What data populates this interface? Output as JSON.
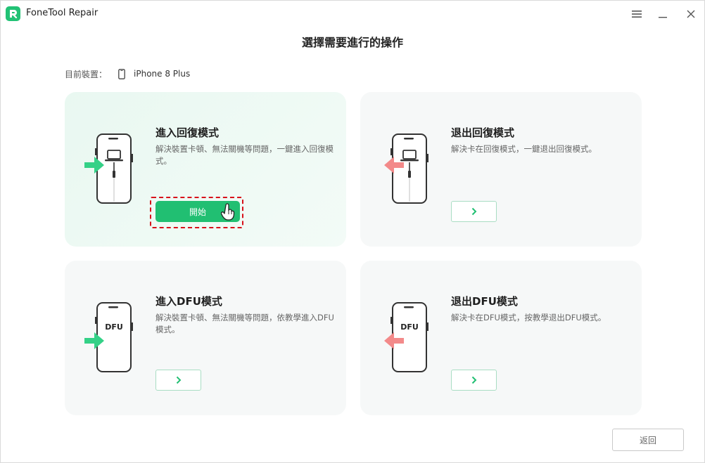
{
  "app": {
    "title": "FoneTool Repair",
    "accent": "#21bf72"
  },
  "window_controls": {
    "menu_icon": "hamburger-menu-icon",
    "minimize_icon": "minimize-icon",
    "close_icon": "close-icon"
  },
  "page": {
    "title": "選擇需要進行的操作"
  },
  "device": {
    "label": "目前裝置：",
    "name": "iPhone 8 Plus",
    "icon": "phone-icon"
  },
  "cards": [
    {
      "title": "進入回復模式",
      "description": "解決裝置卡頓、無法關機等問題，一鍵進入回復模式。",
      "button_label": "開始",
      "arrow_color": "#34d187",
      "illustration": "phone-laptop-enter"
    },
    {
      "title": "退出回復模式",
      "description": "解決卡在回復模式，一鍵退出回復模式。",
      "button_icon": "chevron-right-icon",
      "arrow_color": "#f38a8a",
      "illustration": "phone-laptop-exit"
    },
    {
      "title": "進入DFU模式",
      "description": "解決裝置卡頓、無法關機等問題，依教學進入DFU模式。",
      "button_icon": "chevron-right-icon",
      "screen_text": "DFU",
      "arrow_color": "#34d187",
      "illustration": "phone-dfu-enter"
    },
    {
      "title": "退出DFU模式",
      "description": "解決卡在DFU模式，按教學退出DFU模式。",
      "button_icon": "chevron-right-icon",
      "screen_text": "DFU",
      "arrow_color": "#f38a8a",
      "illustration": "phone-dfu-exit"
    }
  ],
  "footer": {
    "back_label": "返回"
  }
}
